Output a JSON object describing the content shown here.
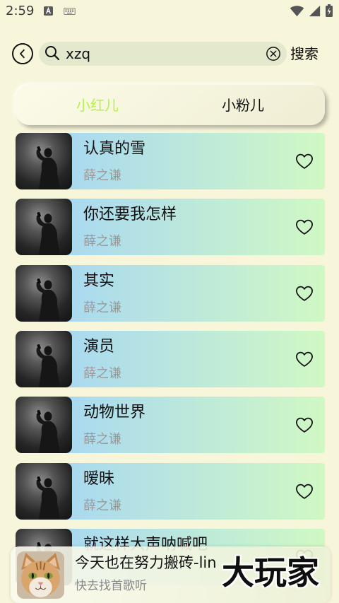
{
  "status_bar": {
    "time": "2:59",
    "left_icons": [
      "text-input-a-icon",
      "keyboard-icon"
    ],
    "right_icons": [
      "wifi-icon",
      "cellular-signal-icon",
      "battery-charging-icon"
    ]
  },
  "search": {
    "back_icon": "back-icon",
    "search_icon": "search-icon",
    "query": "xzq",
    "clear_icon": "clear-icon",
    "submit_label": "搜索"
  },
  "tabs": [
    {
      "label": "小红儿",
      "active": true
    },
    {
      "label": "小粉儿",
      "active": false
    }
  ],
  "songs": [
    {
      "title": "认真的雪",
      "artist": "薛之谦",
      "liked": false
    },
    {
      "title": "你还要我怎样",
      "artist": "薛之谦",
      "liked": false
    },
    {
      "title": "其实",
      "artist": "薛之谦",
      "liked": false
    },
    {
      "title": "演员",
      "artist": "薛之谦",
      "liked": false
    },
    {
      "title": "动物世界",
      "artist": "薛之谦",
      "liked": false
    },
    {
      "title": "暧昧",
      "artist": "薛之谦",
      "liked": false
    },
    {
      "title": "就这样大声呐喊吧",
      "liked": false
    }
  ],
  "player": {
    "title": "今天也在努力搬砖-lin",
    "subtitle": "快去找首歌听"
  },
  "watermark": "大玩家",
  "colors": {
    "background": "#f8f6da",
    "search_field": "#e4e8cc",
    "active_tab": "#b4f24c",
    "row_gradient_start": "#a8d8f2",
    "row_gradient_end": "#d0f8c4",
    "secondary_text": "#9a9a9a"
  }
}
